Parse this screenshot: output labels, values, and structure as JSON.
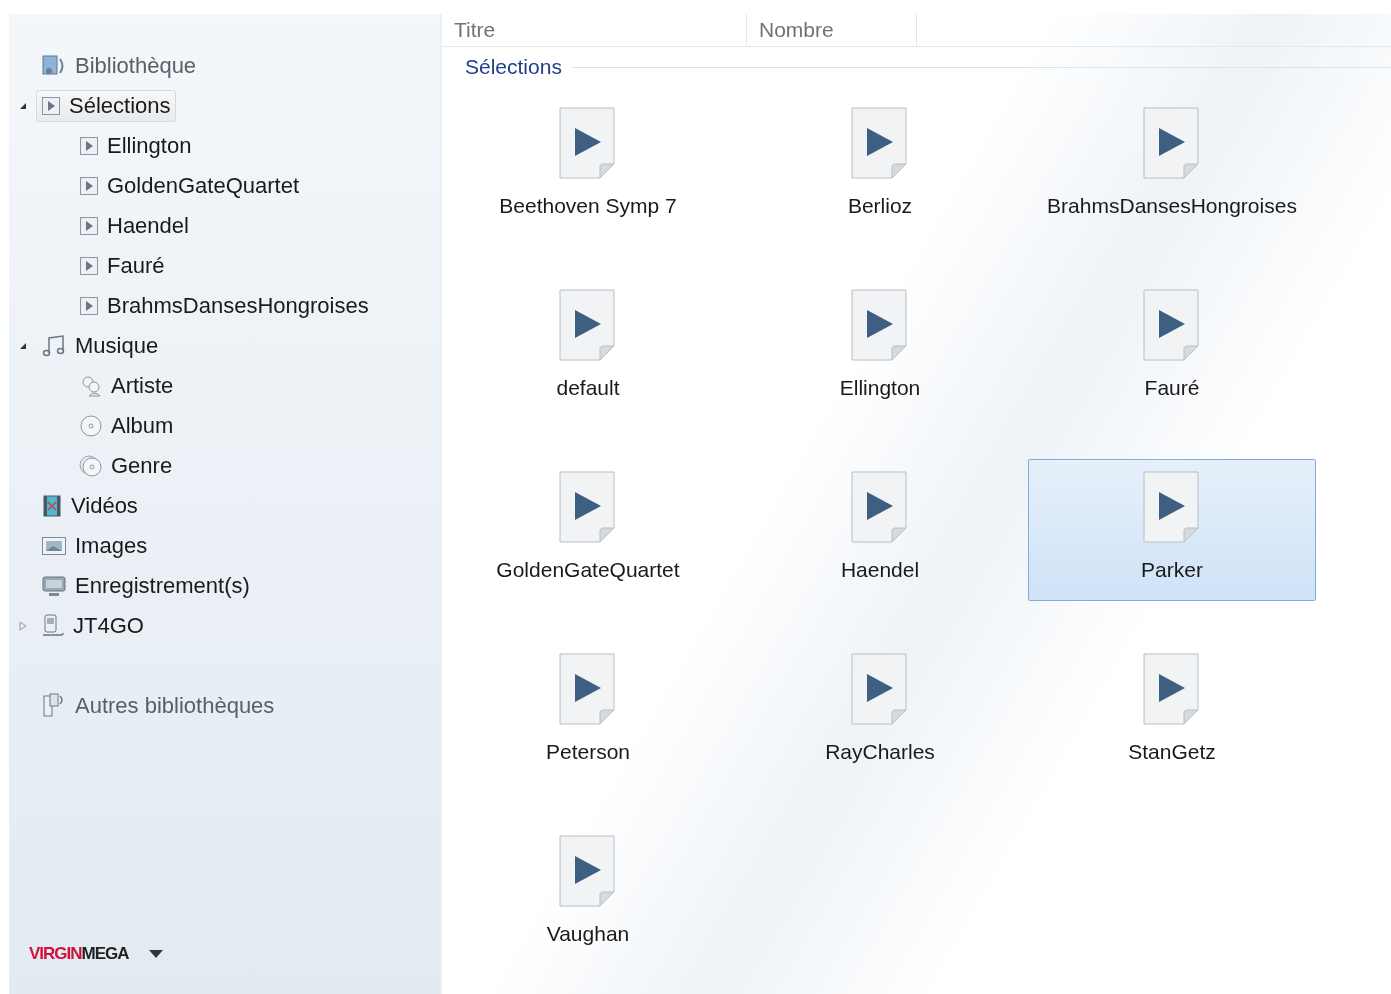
{
  "sidebar": {
    "tree": [
      {
        "label": "Bibliothèque",
        "kind": "library",
        "selected": false
      },
      {
        "label": "Sélections",
        "kind": "playlist",
        "selected": true,
        "expanded": true,
        "children": [
          {
            "label": "Ellington",
            "kind": "playlist",
            "selected": false
          },
          {
            "label": "GoldenGateQuartet",
            "kind": "playlist",
            "selected": false
          },
          {
            "label": "Haendel",
            "kind": "playlist",
            "selected": false
          },
          {
            "label": "Fauré",
            "kind": "playlist",
            "selected": false
          },
          {
            "label": "BrahmsDansesHongroises",
            "kind": "playlist",
            "selected": false
          }
        ]
      },
      {
        "label": "Musique",
        "kind": "music",
        "selected": false,
        "expanded": true,
        "children": [
          {
            "label": "Artiste",
            "kind": "artist",
            "selected": false
          },
          {
            "label": "Album",
            "kind": "album",
            "selected": false
          },
          {
            "label": "Genre",
            "kind": "genre",
            "selected": false
          }
        ]
      },
      {
        "label": "Vidéos",
        "kind": "video",
        "selected": false
      },
      {
        "label": "Images",
        "kind": "images",
        "selected": false
      },
      {
        "label": "Enregistrement(s)",
        "kind": "recorded",
        "selected": false
      },
      {
        "label": "JT4GO",
        "kind": "device",
        "selected": false,
        "expanded": false
      }
    ],
    "other_libraries": {
      "label": "Autres bibliothèques"
    },
    "logo": [
      {
        "text": "VIRGIN",
        "color": "#d0123c"
      },
      {
        "text": "MEGA",
        "color": "#222222"
      }
    ]
  },
  "table": {
    "columns": [
      "Titre",
      "Nombre"
    ]
  },
  "group": {
    "title": "Sélections"
  },
  "items": [
    {
      "label": "Beethoven Symp 7",
      "selected": false
    },
    {
      "label": "Berlioz",
      "selected": false
    },
    {
      "label": "BrahmsDansesHongroises",
      "selected": false
    },
    {
      "label": "default",
      "selected": false
    },
    {
      "label": "Ellington",
      "selected": false
    },
    {
      "label": "Fauré",
      "selected": false
    },
    {
      "label": "GoldenGateQuartet",
      "selected": false
    },
    {
      "label": "Haendel",
      "selected": false
    },
    {
      "label": "Parker",
      "selected": true
    },
    {
      "label": "Peterson",
      "selected": false
    },
    {
      "label": "RayCharles",
      "selected": false
    },
    {
      "label": "StanGetz",
      "selected": false
    },
    {
      "label": "Vaughan",
      "selected": false
    }
  ]
}
